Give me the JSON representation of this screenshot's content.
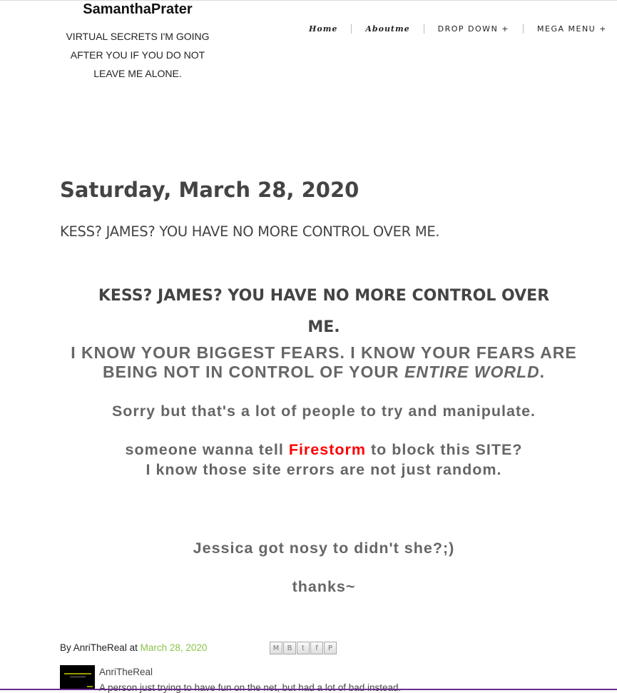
{
  "header": {
    "title": "SamanthaPrater",
    "description_lines": [
      "VIRTUAL SECRETS I'M GOING",
      "AFTER YOU IF YOU DO NOT",
      "LEAVE ME ALONE."
    ]
  },
  "nav": {
    "items": [
      "Home",
      "Aboutme",
      "DROP DOWN +",
      "MEGA MENU +"
    ]
  },
  "post": {
    "date_header": "Saturday, March 28, 2020",
    "title": "KESS? JAMES? YOU HAVE NO MORE CONTROL OVER ME.",
    "body": {
      "heading_line1": "KESS? JAMES? YOU HAVE NO MORE CONTROL OVER",
      "heading_line2": "ME.",
      "fears_line1": "I KNOW YOUR BIGGEST FEARS. I KNOW YOUR FEARS ARE",
      "fears_line2_prefix": "BEING NOT IN CONTROL OF YOUR ",
      "fears_line2_emphasis": "ENTIRE WORLD",
      "fears_line2_suffix": ".",
      "sorry": "Sorry but that's a lot of people to try and manipulate.",
      "firestorm_prefix": "someone wanna tell ",
      "firestorm_name": "Firestorm",
      "firestorm_suffix": " to block this SITE?",
      "errors": "I know those site errors are not just random.",
      "jessica": "Jessica got nosy to didn't she?;)",
      "thanks": "thanks~"
    },
    "byline": {
      "by": "By",
      "author": "AnriTheReal",
      "at": "at",
      "date": "March 28, 2020"
    },
    "share_buttons": [
      "email-share",
      "blogthis-share",
      "twitter-share",
      "facebook-share",
      "pinterest-share"
    ],
    "share_glyphs": [
      "M",
      "B",
      "t",
      "f",
      "P"
    ]
  },
  "author_profile": {
    "name": "AnriTheReal",
    "about": "A person just trying to have fun on the net, but had a lot of bad instead."
  },
  "colors": {
    "link_date": "#8bc34a",
    "firestorm": "#ff0000",
    "bottom_border": "#6a2d8e"
  }
}
